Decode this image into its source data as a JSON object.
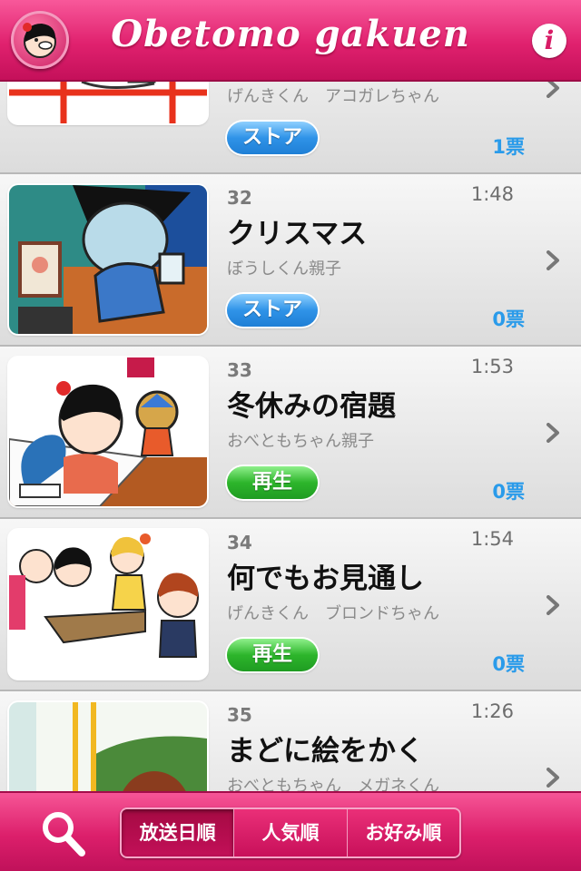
{
  "header": {
    "title": "Obetomo gakuen",
    "info_label": "i"
  },
  "episodes": [
    {
      "num": "",
      "time": "",
      "title": "",
      "sub": "げんきくん　アコガレちゃん",
      "button": "ストア",
      "button_type": "store",
      "votes": "1票"
    },
    {
      "num": "32",
      "time": "1:48",
      "title": "クリスマス",
      "sub": "ぼうしくん親子",
      "button": "ストア",
      "button_type": "store",
      "votes": "0票"
    },
    {
      "num": "33",
      "time": "1:53",
      "title": "冬休みの宿題",
      "sub": "おべともちゃん親子",
      "button": "再生",
      "button_type": "play",
      "votes": "0票"
    },
    {
      "num": "34",
      "time": "1:54",
      "title": "何でもお見通し",
      "sub": "げんきくん　ブロンドちゃん",
      "button": "再生",
      "button_type": "play",
      "votes": "0票"
    },
    {
      "num": "35",
      "time": "1:26",
      "title": "まどに絵をかく",
      "sub": "おべともちゃん　メガネくん",
      "button": "",
      "button_type": "",
      "votes": ""
    }
  ],
  "tabs": [
    {
      "label": "放送日順",
      "active": true
    },
    {
      "label": "人気順",
      "active": false
    },
    {
      "label": "お好み順",
      "active": false
    }
  ],
  "colors": {
    "brand_pink": "#e0216e",
    "store_blue": "#2f93e8",
    "play_green": "#2db52b",
    "votes_blue": "#2a9bea"
  }
}
